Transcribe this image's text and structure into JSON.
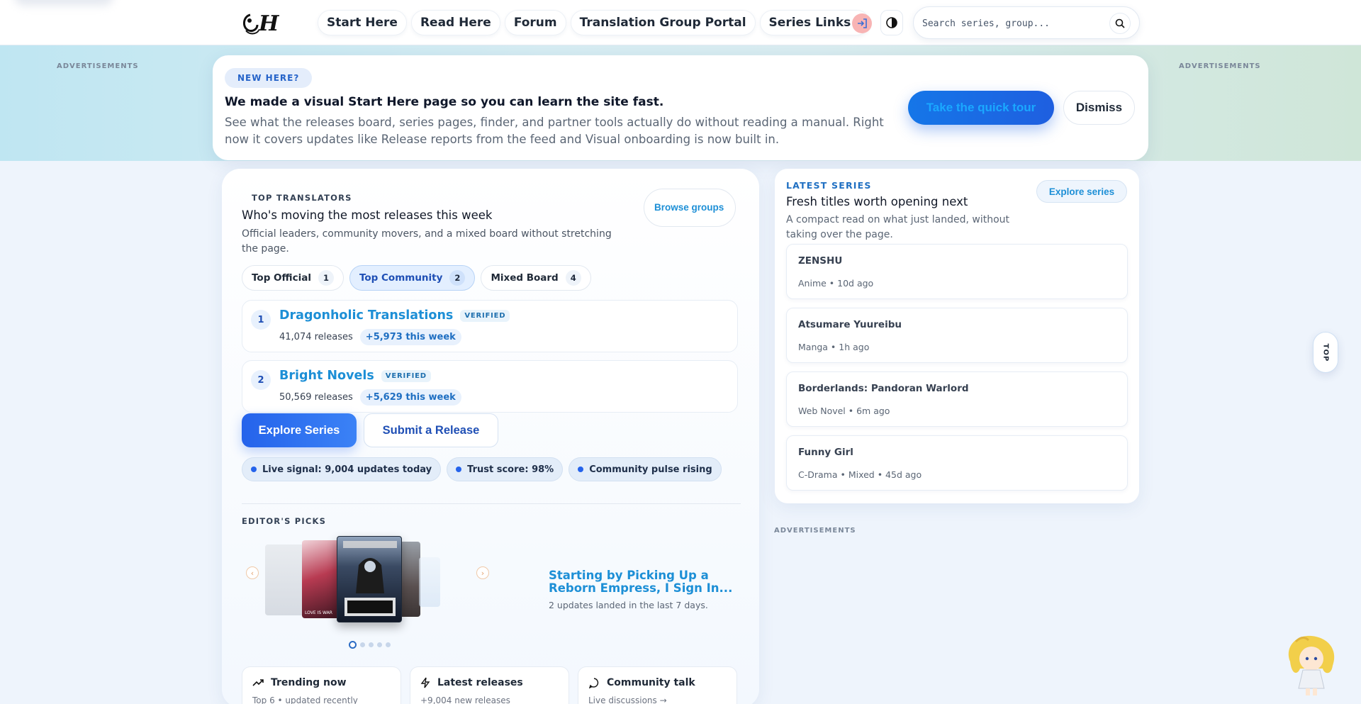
{
  "header": {
    "nav": [
      {
        "label": "Start Here"
      },
      {
        "label": "Read Here"
      },
      {
        "label": "Forum"
      },
      {
        "label": "Translation Group Portal"
      },
      {
        "label": "Series Links"
      }
    ],
    "search_placeholder": "Search series, group..."
  },
  "ads": {
    "label": "ADVERTISEMENTS"
  },
  "banner": {
    "pill": "NEW HERE?",
    "title": "We made a visual Start Here page so you can learn the site fast.",
    "description": "See what the releases board, series pages, finder, and partner tools actually do without reading a manual. Right now it covers updates like Release reports from the feed and Visual onboarding is now built in.",
    "tour_label": "Take the quick tour",
    "dismiss_label": "Dismiss"
  },
  "translators": {
    "eyebrow": "TOP TRANSLATORS",
    "title": "Who's moving the most releases this week",
    "description": "Official leaders, community movers, and a mixed board without stretching the page.",
    "browse_label": "Browse groups",
    "tabs": [
      {
        "label": "Top Official",
        "count": "1"
      },
      {
        "label": "Top Community",
        "count": "2"
      },
      {
        "label": "Mixed Board",
        "count": "4"
      }
    ],
    "rows": [
      {
        "rank": "1",
        "name": "Dragonholic Translations",
        "badge": "VERIFIED",
        "releases": "41,074 releases",
        "week": "+5,973 this week"
      },
      {
        "rank": "2",
        "name": "Bright Novels",
        "badge": "VERIFIED",
        "releases": "50,569 releases",
        "week": "+5,629 this week"
      }
    ],
    "explore_label": "Explore Series",
    "submit_label": "Submit a Release",
    "signals": [
      "Live signal: 9,004 updates today",
      "Trust score: 98%",
      "Community pulse rising"
    ]
  },
  "editors_picks": {
    "eyebrow": "EDITOR'S PICKS",
    "title": "Starting by Picking Up a Reborn Empress, I Sign In...",
    "subtitle": "2 updates landed in the last 7 days.",
    "cover_text": "LOVE IS WAR"
  },
  "mini_cards": [
    {
      "title": "Trending now",
      "sub": "Top 6 • updated recently",
      "icon": "trending-icon"
    },
    {
      "title": "Latest releases",
      "sub": "+9,004 new releases",
      "icon": "bolt-icon"
    },
    {
      "title": "Community talk",
      "sub": "Live discussions →",
      "icon": "chat-icon"
    }
  ],
  "latest_series": {
    "eyebrow": "LATEST SERIES",
    "title": "Fresh titles worth opening next",
    "description": "A compact read on what just landed, without taking over the page.",
    "explore_label": "Explore series",
    "items": [
      {
        "title": "ZENSHU",
        "meta": "Anime • 10d ago"
      },
      {
        "title": "Atsumare Yuureibu",
        "meta": "Manga • 1h ago"
      },
      {
        "title": "Borderlands: Pandoran Warlord",
        "meta": "Web Novel • 6m ago"
      },
      {
        "title": "Funny Girl",
        "meta": "C-Drama • Mixed • 45d ago"
      }
    ]
  },
  "top_button": "TOP",
  "colors": {
    "accent": "#1d8fd6",
    "primary": "#2563eb"
  }
}
